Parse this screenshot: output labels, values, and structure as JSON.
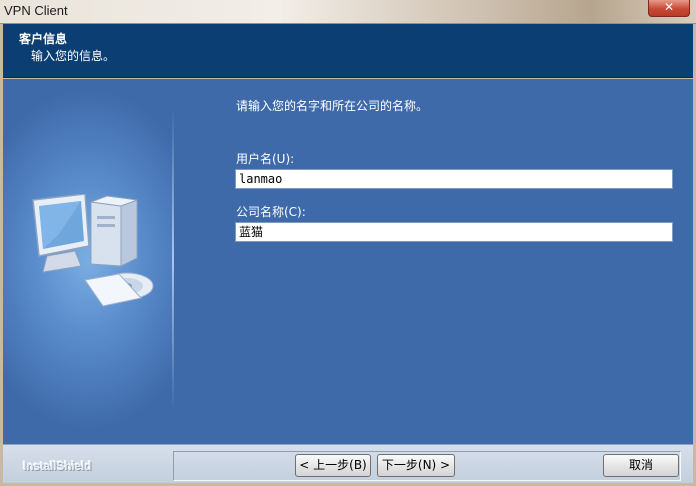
{
  "window": {
    "title": "VPN Client",
    "close_glyph": "✕"
  },
  "header": {
    "title": "客户信息",
    "subtitle": "输入您的信息。"
  },
  "main": {
    "prompt": "请输入您的名字和所在公司的名称。",
    "username": {
      "label": "用户名(U):",
      "value": "lanmao"
    },
    "company": {
      "label": "公司名称(C):",
      "value": "蓝猫"
    },
    "illustration_icon": "computer-with-cd-icon"
  },
  "footer": {
    "brand": "InstallShield",
    "back_label": "< 上一步(B)",
    "next_label": "下一步(N) >",
    "cancel_label": "取消"
  }
}
